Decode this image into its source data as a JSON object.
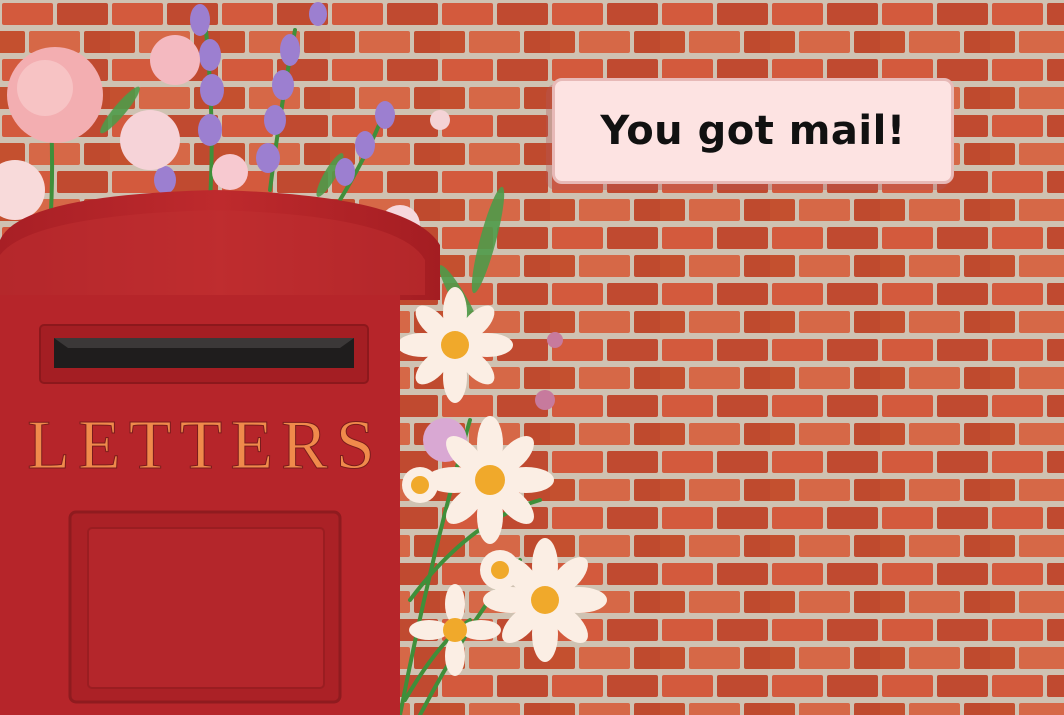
{
  "headline": "You got mail!",
  "mailbox": {
    "label": "LETTERS"
  },
  "colors": {
    "brick_light": "#d4634a",
    "brick_dark": "#b84229",
    "mortar": "#cfc2b2",
    "postbox_red": "#b6252a",
    "headline_bg": "#fde3e2"
  },
  "decorations": [
    "lavender-sprigs",
    "pink-flowers",
    "daisies",
    "green-stems"
  ]
}
